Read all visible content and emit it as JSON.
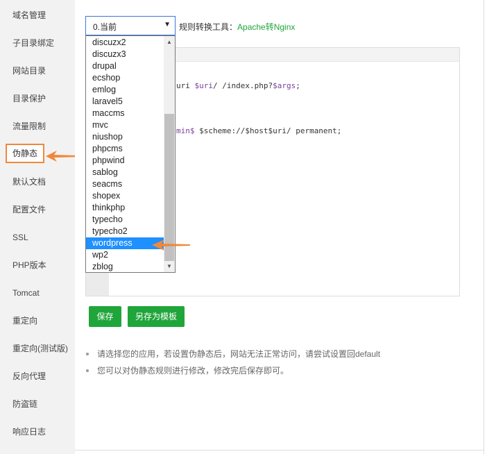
{
  "sidebar": {
    "items": [
      {
        "label": "域名管理"
      },
      {
        "label": "子目录绑定"
      },
      {
        "label": "网站目录"
      },
      {
        "label": "目录保护"
      },
      {
        "label": "流量限制"
      },
      {
        "label": "伪静态"
      },
      {
        "label": "默认文档"
      },
      {
        "label": "配置文件"
      },
      {
        "label": "SSL"
      },
      {
        "label": "PHP版本"
      },
      {
        "label": "Tomcat"
      },
      {
        "label": "重定向"
      },
      {
        "label": "重定向(测试版)"
      },
      {
        "label": "反向代理"
      },
      {
        "label": "防盗链"
      },
      {
        "label": "响应日志"
      }
    ],
    "active_index": 5
  },
  "rewrite": {
    "select_value": "0.当前",
    "tool_label": "规则转换工具：",
    "tool_link": "Apache转Nginx",
    "dropdown_options": [
      "discuzx2",
      "discuzx3",
      "drupal",
      "ecshop",
      "emlog",
      "laravel5",
      "maccms",
      "mvc",
      "niushop",
      "phpcms",
      "phpwind",
      "sablog",
      "seacms",
      "shopex",
      "thinkphp",
      "typecho",
      "typecho2",
      "wordpress",
      "wp2",
      "zblog"
    ],
    "selected_option": "wordpress"
  },
  "editor": {
    "line1_pre": "uri ",
    "line1_var1": "$uri",
    "line1_mid": "/ /index.php?",
    "line1_var2": "$args",
    "line1_post": ";",
    "line2_pre": "min$ ",
    "line2_text": "$scheme://$host$uri/ permanent;"
  },
  "buttons": {
    "save": "保存",
    "save_as_template": "另存为模板"
  },
  "tips": [
    "请选择您的应用，若设置伪静态后，网站无法正常访问，请尝试设置回default",
    "您可以对伪静态规则进行修改，修改完后保存即可。"
  ],
  "colors": {
    "accent_green": "#20a53a",
    "highlight_orange": "#f0883b",
    "selection_blue": "#1e90ff"
  },
  "icons": {
    "select_caret": "▼",
    "scroll_up": "▲",
    "scroll_down": "▼"
  }
}
